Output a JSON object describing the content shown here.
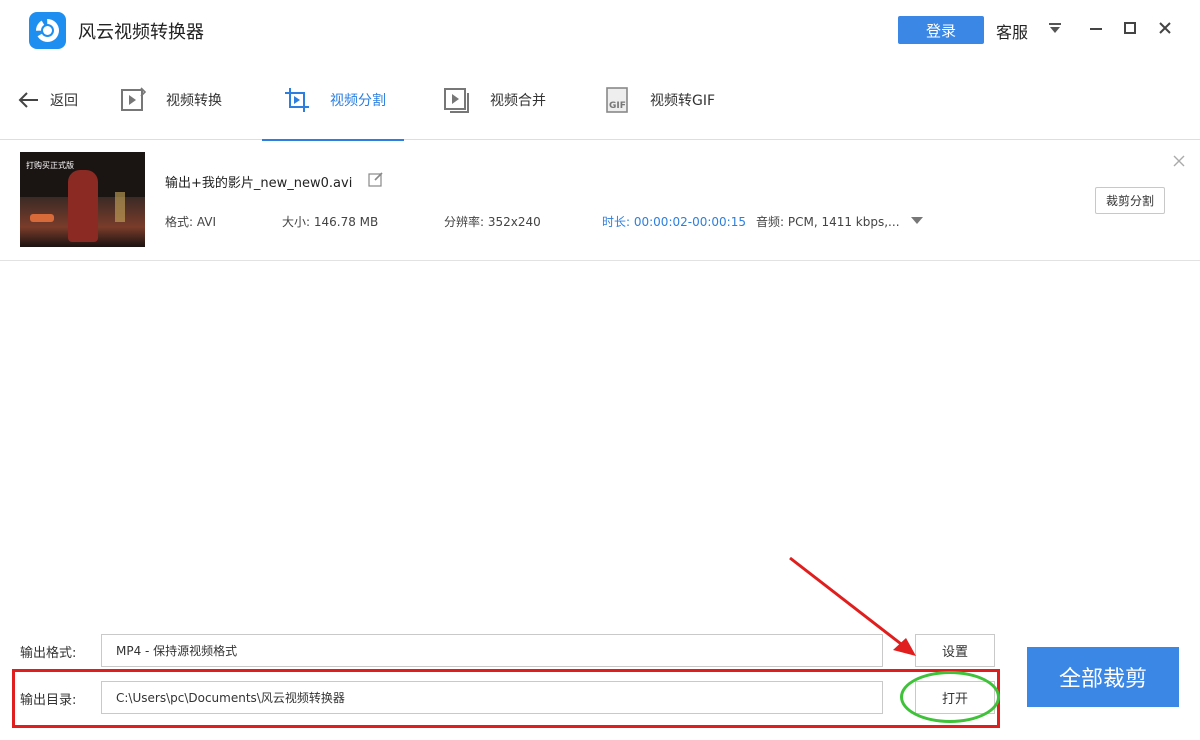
{
  "app": {
    "title": "风云视频转换器",
    "login_label": "登录",
    "service_label": "客服",
    "accent_color": "#3b87e6"
  },
  "toolbar": {
    "back_label": "返回",
    "tabs": [
      {
        "label": "视频转换",
        "icon": "video-convert-icon",
        "active": false
      },
      {
        "label": "视频分割",
        "icon": "video-crop-icon",
        "active": true
      },
      {
        "label": "视频合并",
        "icon": "video-merge-icon",
        "active": false
      },
      {
        "label": "视频转GIF",
        "icon": "gif-icon",
        "active": false
      }
    ]
  },
  "file": {
    "thumbnail_caption": "打购买正式版",
    "name": "输出+我的影片_new_new0.avi",
    "format": "格式: AVI",
    "size": "大小: 146.78 MB",
    "resolution": "分辨率: 352x240",
    "duration": "时长: 00:00:02-00:00:15",
    "audio": "音频: PCM, 1411 kbps,...",
    "clip_label": "裁剪分割"
  },
  "output": {
    "format_label": "输出格式:",
    "format_value": "MP4 - 保持源视频格式",
    "settings_label": "设置",
    "dir_label": "输出目录:",
    "dir_value": "C:\\Users\\pc\\Documents\\风云视频转换器",
    "open_label": "打开",
    "cut_all_label": "全部裁剪"
  },
  "annotation_colors": {
    "box": "#e01e1e",
    "ellipse": "#3fc23a",
    "arrow": "#e01e1e"
  }
}
